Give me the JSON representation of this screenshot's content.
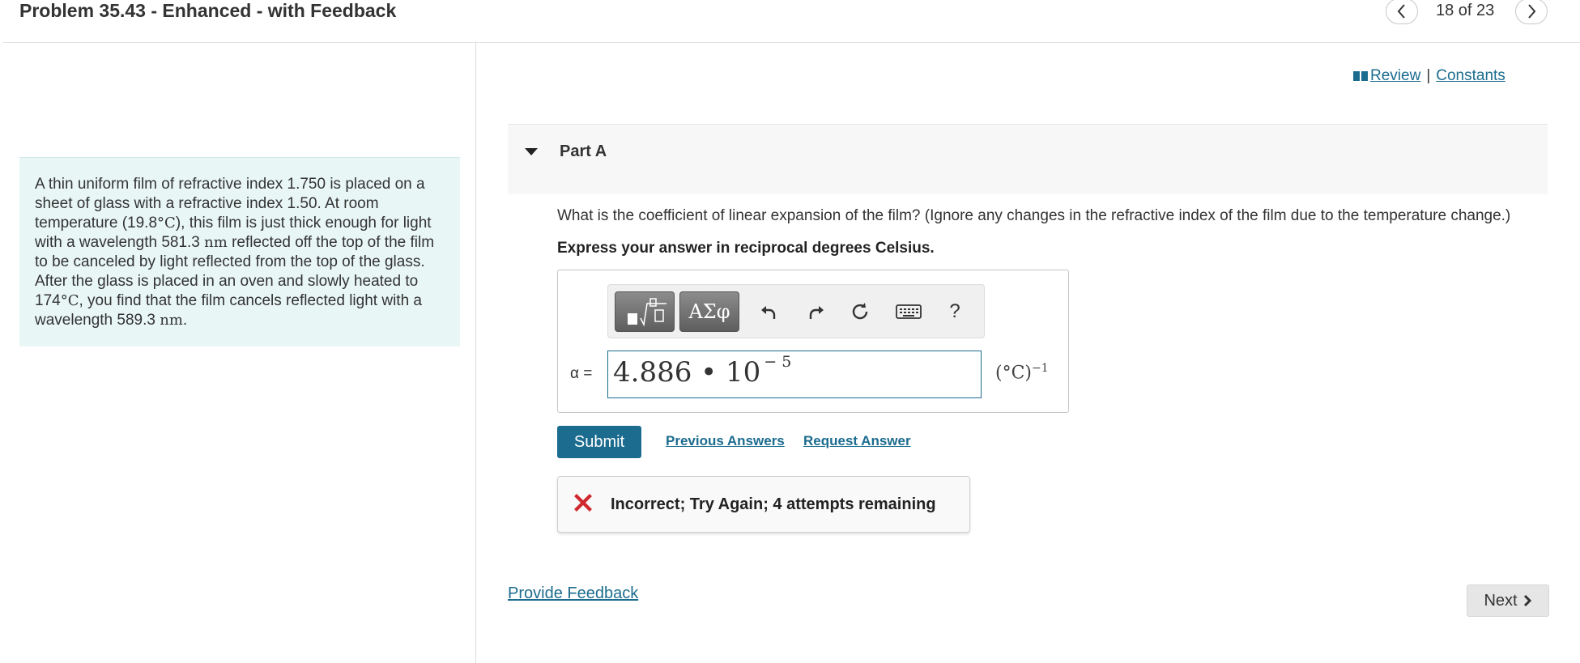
{
  "header": {
    "title": "Problem 35.43 - Enhanced - with Feedback",
    "counter": "18 of 23",
    "prev_icon": "chevron-left-icon",
    "next_icon": "chevron-right-icon"
  },
  "statement": {
    "t1": "A thin uniform film of refractive index 1.750 is placed on a sheet of glass with a refractive index 1.50. At room temperature (19.8",
    "deg1": "°C",
    "t2": "), this film is just thick enough for light with a wavelength 581.3 ",
    "nm1": "nm",
    "t3": " reflected off the top of the film to be canceled by light reflected from the top of the glass. After the glass is placed in an oven and slowly heated to 174",
    "deg2": "°C",
    "t4": ", you find that the film cancels reflected light with a wavelength 589.3 ",
    "nm2": "nm",
    "t5": "."
  },
  "links": {
    "review": "Review",
    "separator": "|",
    "constants": "Constants"
  },
  "part": {
    "label": "Part A",
    "question": "What is the coefficient of linear expansion of the film? (Ignore any changes in the refractive index of the film due to the temperature change.)",
    "instruction": "Express your answer in reciprocal degrees Celsius."
  },
  "toolbar": {
    "template_icon": "fraction-sqrt-template-icon",
    "greek_label": "ΑΣφ",
    "undo_icon": "undo-icon",
    "redo_icon": "redo-icon",
    "reset_icon": "reset-icon",
    "keyboard_icon": "keyboard-icon",
    "help_label": "?"
  },
  "answer": {
    "variable": "α =",
    "value": "4.886 • 10",
    "exponent": "− 5",
    "unit": "(°C)",
    "unit_exp": "−1"
  },
  "actions": {
    "submit": "Submit",
    "previous_answers": "Previous Answers",
    "request_answer": "Request Answer"
  },
  "feedback": {
    "message": "Incorrect; Try Again; 4 attempts remaining"
  },
  "footer": {
    "provide_feedback": "Provide Feedback",
    "next": "Next"
  },
  "colors": {
    "link": "#1c6c8f",
    "submit_bg": "#1c6c8f",
    "statement_bg": "#e9f6f6",
    "error": "#d0282e"
  }
}
